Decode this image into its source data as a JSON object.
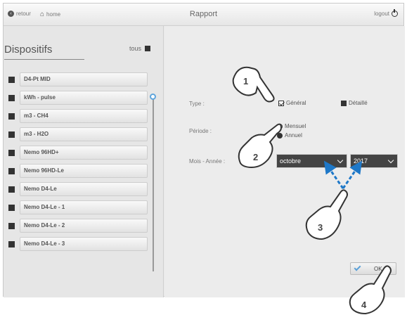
{
  "topbar": {
    "back_label": "retour",
    "home_label": "home",
    "title": "Rapport",
    "logout_label": "logout"
  },
  "devices": {
    "title": "Dispositifs",
    "all_label": "tous",
    "items": [
      {
        "label": "D4-Pt MID"
      },
      {
        "label": "kWh - pulse"
      },
      {
        "label": "m3 - CH4"
      },
      {
        "label": "m3 - H2O"
      },
      {
        "label": "Nemo 96HD+"
      },
      {
        "label": "Nemo 96HD-Le"
      },
      {
        "label": "Nemo D4-Le"
      },
      {
        "label": "Nemo D4-Le - 1"
      },
      {
        "label": "Nemo D4-Le - 2"
      },
      {
        "label": "Nemo D4-Le - 3"
      }
    ]
  },
  "form": {
    "type_label": "Type :",
    "type_general": "Général",
    "type_detailed": "Détaillé",
    "period_label": "Période :",
    "period_monthly": "Mensuel",
    "period_yearly": "Annuel",
    "month_year_label": "Mois - Année :",
    "month_value": "octobre",
    "year_value": "2017",
    "ok_label": "OK"
  },
  "callouts": [
    "1",
    "2",
    "3",
    "4"
  ],
  "colors": {
    "accent": "#5fa5dc",
    "dark_select": "#444444"
  }
}
